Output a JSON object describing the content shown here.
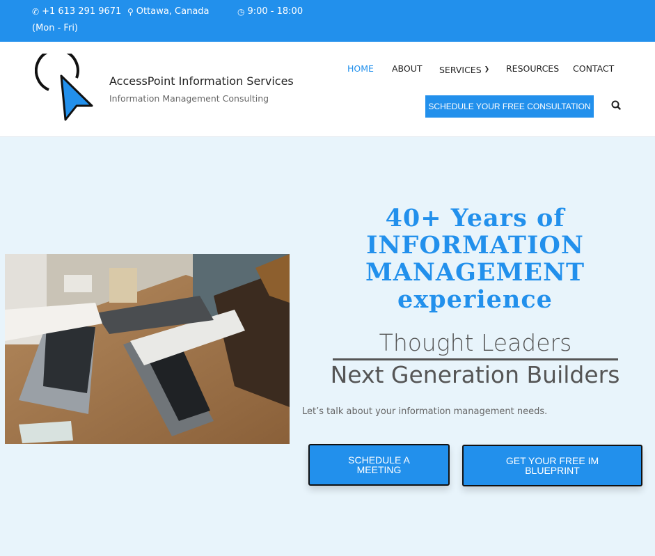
{
  "topbar": {
    "phone": "+1 613 291 9671",
    "location": "Ottawa, Canada",
    "hours": "9:00 - 18:00",
    "days": "(Mon - Fri)"
  },
  "brand": {
    "title": "AccessPoint Information Services",
    "subtitle": "Information Management Consulting"
  },
  "nav": {
    "home": "HOME",
    "about": "ABOUT",
    "services": "SERVICES",
    "resources": "RESOURCES",
    "contact": "CONTACT"
  },
  "cta_top": "SCHEDULE YOUR FREE CONSULTATION",
  "hero": {
    "line1": "40+ Years of",
    "line2": "INFORMATION",
    "line3": "MANAGEMENT",
    "line4": "experience",
    "thought": "Thought Leaders",
    "nextgen": "Next Generation Builders",
    "talk": "Let’s talk about your information management needs.",
    "btn_meeting": "SCHEDULE A MEETING",
    "btn_blueprint": "GET YOUR FREE IM BLUEPRINT"
  },
  "colors": {
    "accent": "#2290ec",
    "hero_bg": "#e8f4fb"
  }
}
